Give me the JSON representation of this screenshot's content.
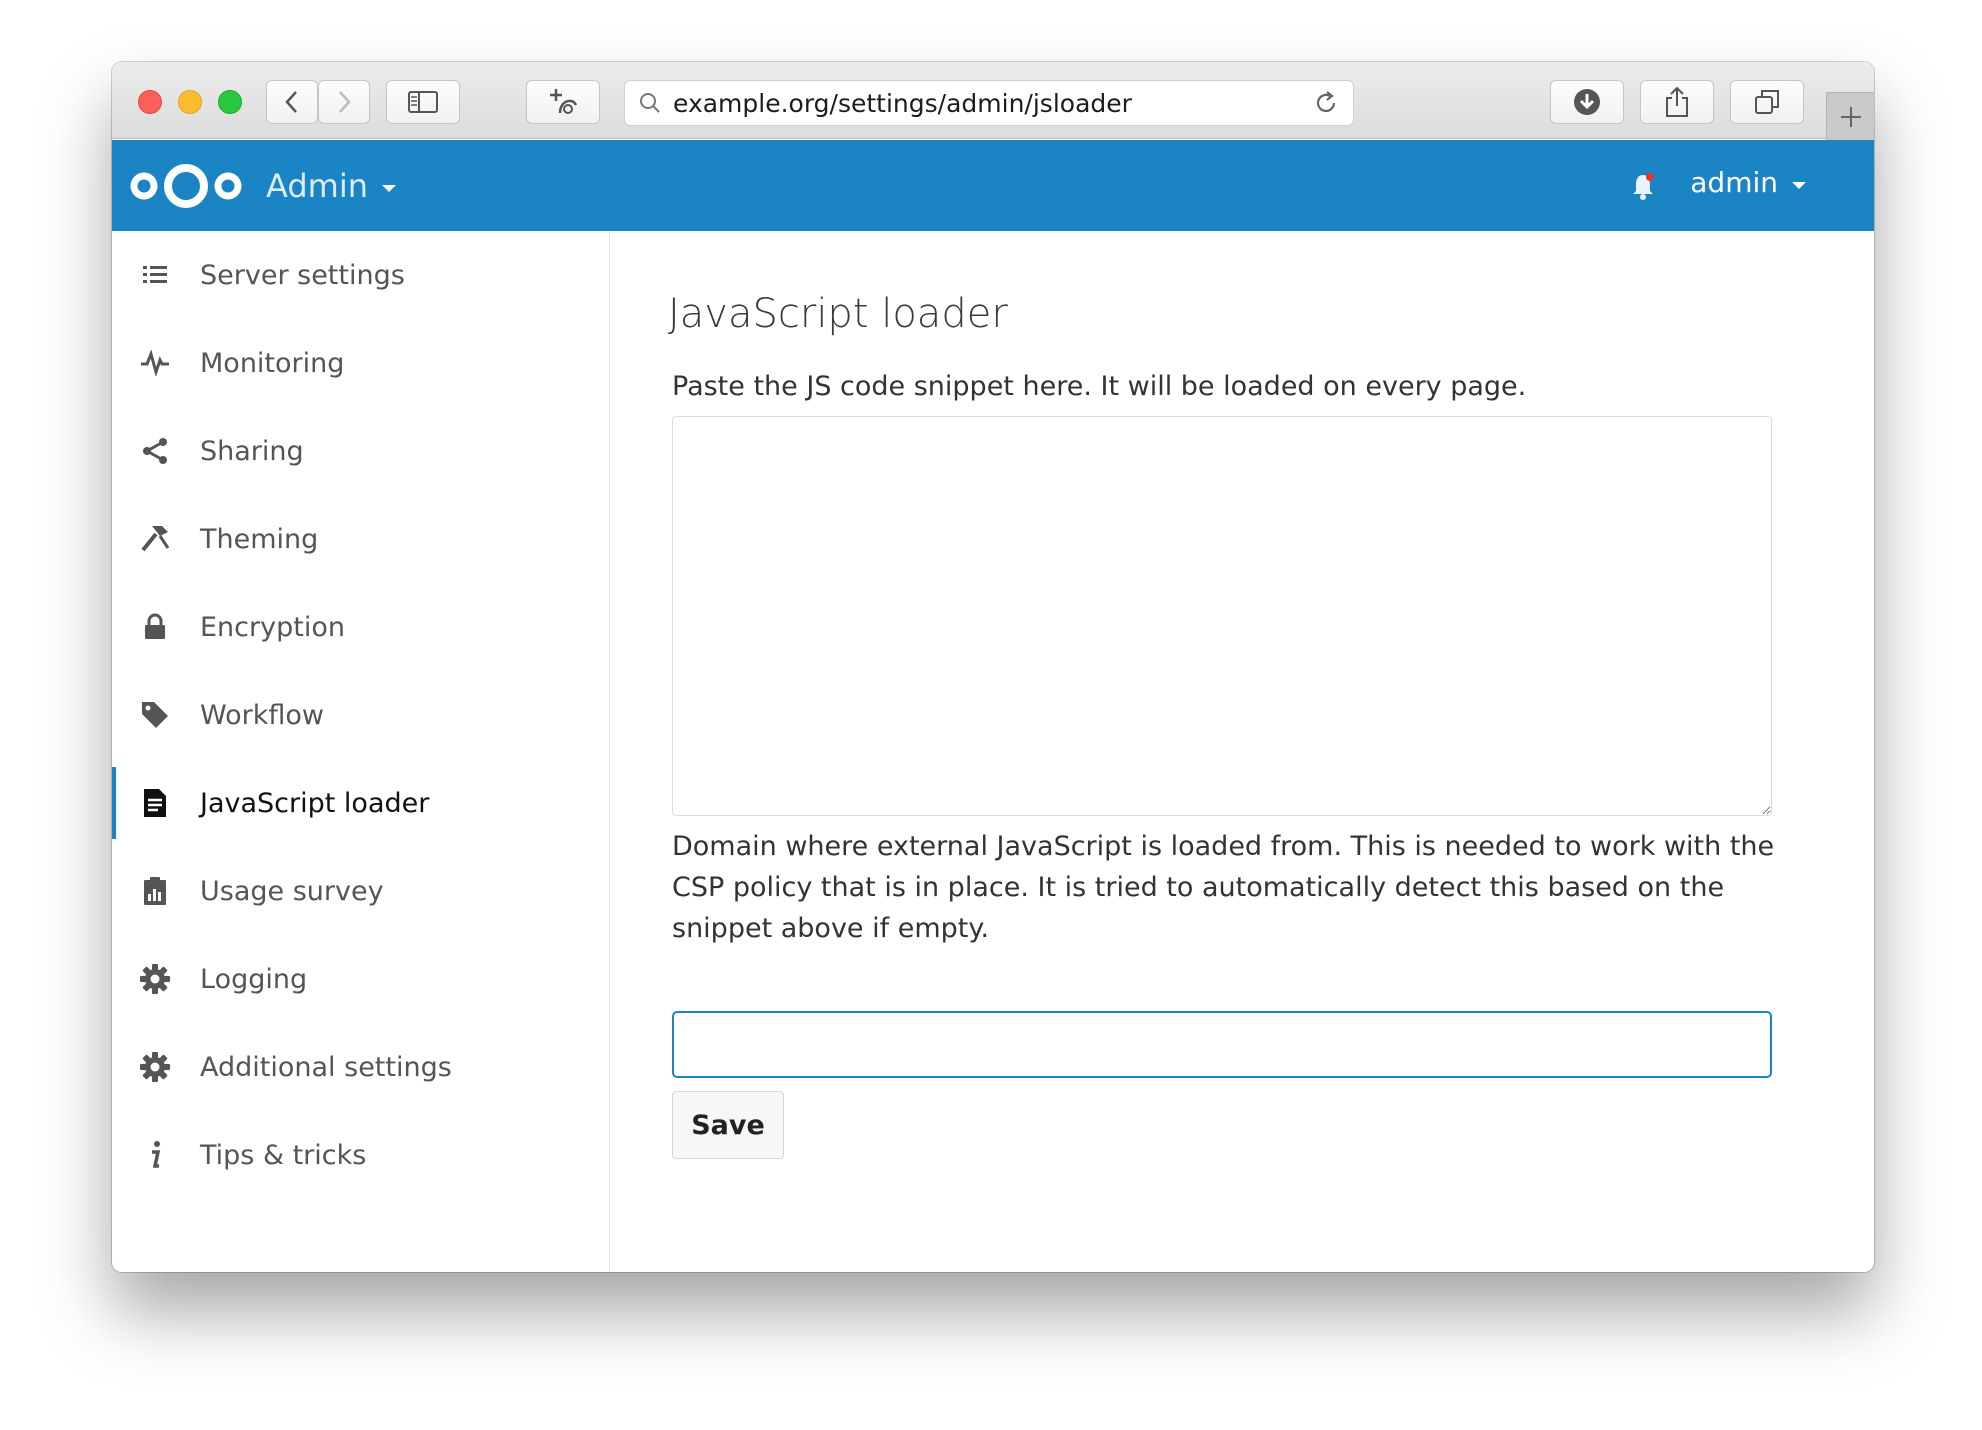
{
  "browser": {
    "url": "example.org/settings/admin/jsloader"
  },
  "header": {
    "app_title": "Admin",
    "user": "admin",
    "brand_color": "#1b84c5"
  },
  "sidebar": {
    "items": [
      {
        "label": "Server settings",
        "icon": "list-icon"
      },
      {
        "label": "Monitoring",
        "icon": "pulse-icon"
      },
      {
        "label": "Sharing",
        "icon": "share-icon"
      },
      {
        "label": "Theming",
        "icon": "hammer-icon"
      },
      {
        "label": "Encryption",
        "icon": "lock-icon"
      },
      {
        "label": "Workflow",
        "icon": "tag-icon"
      },
      {
        "label": "JavaScript loader",
        "icon": "document-icon",
        "active": true
      },
      {
        "label": "Usage survey",
        "icon": "clipboard-chart-icon"
      },
      {
        "label": "Logging",
        "icon": "gear-icon"
      },
      {
        "label": "Additional settings",
        "icon": "gear-icon"
      },
      {
        "label": "Tips & tricks",
        "icon": "info-icon"
      }
    ]
  },
  "main": {
    "title": "JavaScript loader",
    "snippet_hint": "Paste the JS code snippet here. It will be loaded on every page.",
    "snippet_value": "",
    "domain_hint": "Domain where external JavaScript is loaded from. This is needed to work with the CSP policy that is in place. It is tried to automatically detect this based on the snippet above if empty.",
    "domain_value": "",
    "save_label": "Save"
  }
}
